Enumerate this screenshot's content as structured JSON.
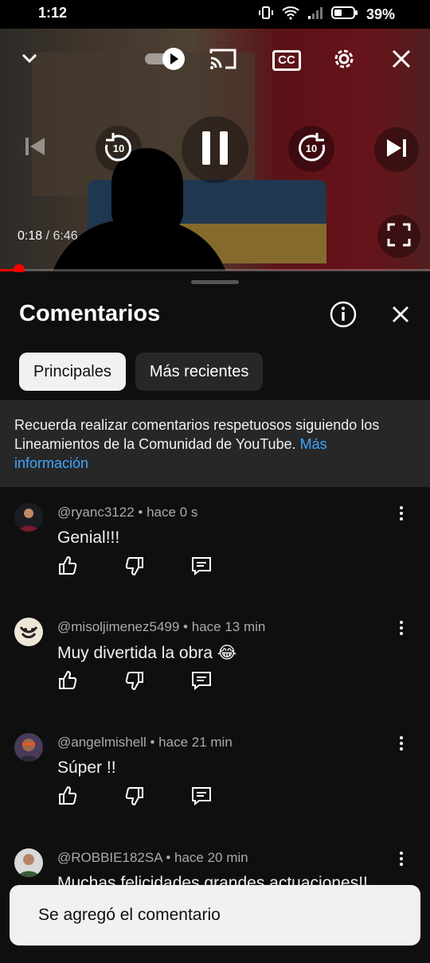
{
  "status_bar": {
    "time": "1:12",
    "battery": "39%"
  },
  "player": {
    "current_time": "0:18",
    "separator": "/",
    "duration": "6:46",
    "progress": 0.045,
    "cc_label": "CC"
  },
  "comments_sheet": {
    "title": "Comentarios",
    "tabs": [
      {
        "label": "Principales",
        "active": true
      },
      {
        "label": "Más recientes",
        "active": false
      }
    ],
    "notice_text": "Recuerda realizar comentarios respetuosos siguiendo los Lineamientos de la Comunidad de YouTube.",
    "notice_link": "Más información",
    "comments": [
      {
        "author": "@ryanc3122",
        "time": "hace 0 s",
        "text": "Genial!!!"
      },
      {
        "author": "@misoljimenez5499",
        "time": "hace 13 min",
        "text": "Muy divertida la obra 😂"
      },
      {
        "author": "@angelmishell",
        "time": "hace 21 min",
        "text": "Súper !!"
      },
      {
        "author": "@ROBBIE182SA",
        "time": "hace 20 min",
        "text": "Muchas felicidades grandes actuaciones!!"
      }
    ]
  },
  "toast": {
    "text": "Se agregó el comentario"
  },
  "colors": {
    "accent": "#ff0000",
    "link": "#3ea6ff",
    "background": "#0f0f0f"
  }
}
